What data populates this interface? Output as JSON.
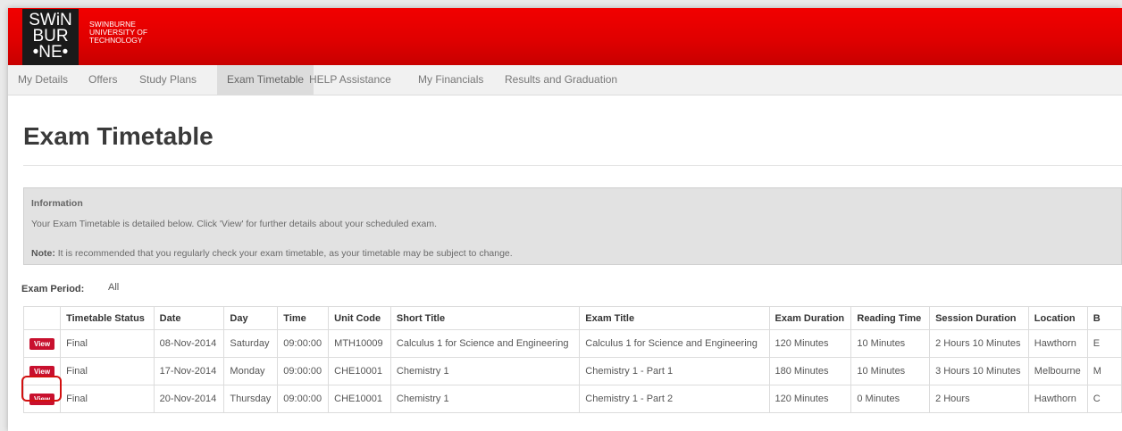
{
  "logo": {
    "lines": [
      "SWiN",
      "BUR",
      "•NE•"
    ],
    "name_lines": [
      "SWINBURNE",
      "UNIVERSITY OF",
      "TECHNOLOGY"
    ]
  },
  "nav": {
    "items": [
      {
        "label": "My Details"
      },
      {
        "label": "Offers"
      },
      {
        "label": "Study Plans"
      },
      {
        "label": "Exam Timetable"
      },
      {
        "label": "HELP Assistance"
      },
      {
        "label": "My Financials"
      },
      {
        "label": "Results and Graduation"
      }
    ],
    "active": "Exam Timetable"
  },
  "page_title": "Exam Timetable",
  "info": {
    "heading": "Information",
    "line1": "Your Exam Timetable is detailed below. Click 'View' for further details about your scheduled exam.",
    "note_label": "Note:",
    "note_text": " It is recommended that you regularly check your exam timetable, as your timetable may be subject to change."
  },
  "exam_period": {
    "label": "Exam Period:",
    "value": "All"
  },
  "table": {
    "headers": [
      "",
      "Timetable Status",
      "Date",
      "Day",
      "Time",
      "Unit Code",
      "Short Title",
      "Exam Title",
      "Exam Duration",
      "Reading Time",
      "Session Duration",
      "Location",
      "B"
    ],
    "view_label": "View",
    "rows": [
      [
        "Final",
        "08-Nov-2014",
        "Saturday",
        "09:00:00",
        "MTH10009",
        "Calculus 1 for Science and Engineering",
        "Calculus 1 for Science and Engineering",
        "120 Minutes",
        "10 Minutes",
        "2 Hours 10 Minutes",
        "Hawthorn",
        "E"
      ],
      [
        "Final",
        "17-Nov-2014",
        "Monday",
        "09:00:00",
        "CHE10001",
        "Chemistry 1",
        "Chemistry 1 - Part 1",
        "180 Minutes",
        "10 Minutes",
        "3 Hours 10 Minutes",
        "Melbourne",
        "M"
      ],
      [
        "Final",
        "20-Nov-2014",
        "Thursday",
        "09:00:00",
        "CHE10001",
        "Chemistry 1",
        "Chemistry 1 - Part 2",
        "120 Minutes",
        "0 Minutes",
        "2 Hours",
        "Hawthorn",
        "C"
      ]
    ]
  },
  "colors": {
    "brand_red": "#e00000",
    "button_red": "#c8102e",
    "highlight": "#d21010"
  }
}
